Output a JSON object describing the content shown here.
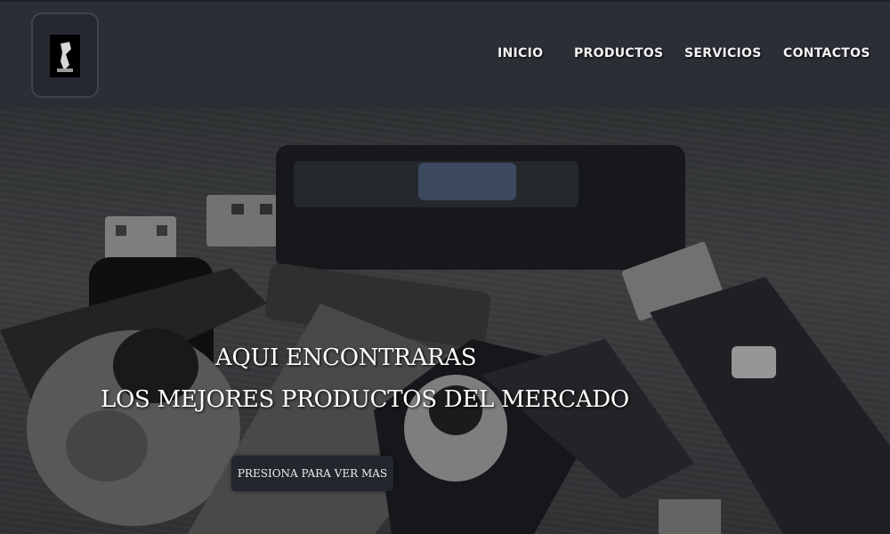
{
  "header": {
    "logo_alt": "logo-icon",
    "nav": [
      {
        "label": "INICIO"
      },
      {
        "label": "PRODUCTOS"
      },
      {
        "label": "SERVICIOS"
      },
      {
        "label": "CONTACTOS"
      }
    ]
  },
  "hero": {
    "headline_line1": "AQUI ENCONTRARAS",
    "headline_line2": "LOS MEJORES PRODUCTOS DEL MERCADO",
    "cta_label": "PRESIONA PARA VER MAS",
    "background_description_icons": [
      "usb-drive-icon"
    ]
  },
  "colors": {
    "header_bg": "#2a2e35",
    "hero_overlay": "#3a3d40",
    "cta_bg": "#23272d",
    "text": "#ffffff"
  }
}
